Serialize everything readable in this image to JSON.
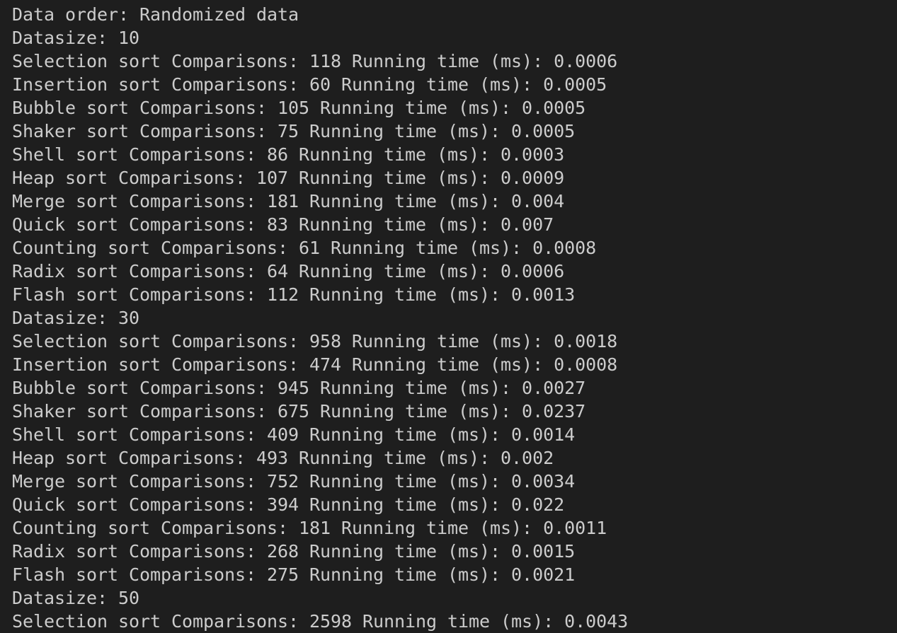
{
  "terminal": {
    "lines": [
      "Data order: Randomized data",
      "Datasize: 10",
      "Selection sort Comparisons: 118 Running time (ms): 0.0006",
      "Insertion sort Comparisons: 60 Running time (ms): 0.0005",
      "Bubble sort Comparisons: 105 Running time (ms): 0.0005",
      "Shaker sort Comparisons: 75 Running time (ms): 0.0005",
      "Shell sort Comparisons: 86 Running time (ms): 0.0003",
      "Heap sort Comparisons: 107 Running time (ms): 0.0009",
      "Merge sort Comparisons: 181 Running time (ms): 0.004",
      "Quick sort Comparisons: 83 Running time (ms): 0.007",
      "Counting sort Comparisons: 61 Running time (ms): 0.0008",
      "Radix sort Comparisons: 64 Running time (ms): 0.0006",
      "Flash sort Comparisons: 112 Running time (ms): 0.0013",
      "Datasize: 30",
      "Selection sort Comparisons: 958 Running time (ms): 0.0018",
      "Insertion sort Comparisons: 474 Running time (ms): 0.0008",
      "Bubble sort Comparisons: 945 Running time (ms): 0.0027",
      "Shaker sort Comparisons: 675 Running time (ms): 0.0237",
      "Shell sort Comparisons: 409 Running time (ms): 0.0014",
      "Heap sort Comparisons: 493 Running time (ms): 0.002",
      "Merge sort Comparisons: 752 Running time (ms): 0.0034",
      "Quick sort Comparisons: 394 Running time (ms): 0.022",
      "Counting sort Comparisons: 181 Running time (ms): 0.0011",
      "Radix sort Comparisons: 268 Running time (ms): 0.0015",
      "Flash sort Comparisons: 275 Running time (ms): 0.0021",
      "Datasize: 50",
      "Selection sort Comparisons: 2598 Running time (ms): 0.0043"
    ]
  },
  "colors": {
    "background": "#1e1e1e",
    "text": "#cccccc"
  }
}
